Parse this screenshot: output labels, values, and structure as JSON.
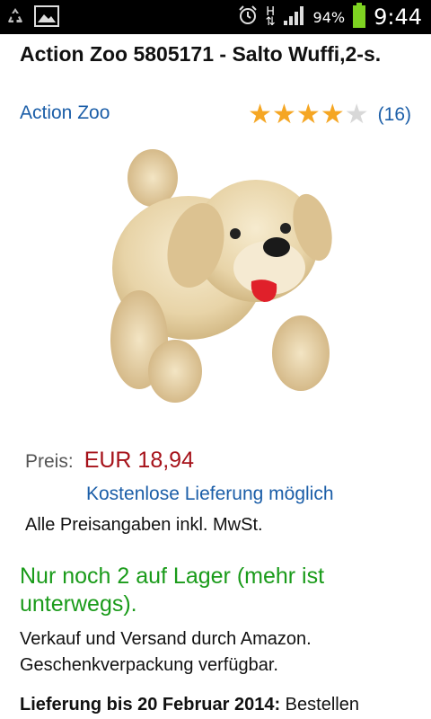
{
  "status_bar": {
    "battery_percent": "94%",
    "time": "9:44",
    "network": "H",
    "icons": [
      "recycle-icon",
      "image-icon",
      "alarm-icon",
      "signal-icon",
      "battery-icon"
    ]
  },
  "product": {
    "title": "Action Zoo 5805171 - Salto Wuffi,2-s.",
    "brand": "Action Zoo",
    "rating": 4,
    "rating_max": 5,
    "review_count": "(16)",
    "image_icon": "plush-dog-image"
  },
  "pricing": {
    "label": "Preis:",
    "value": "EUR 18,94",
    "delivery_link": "Kostenlose Lieferung möglich",
    "vat_note": "Alle Preisangaben inkl. MwSt."
  },
  "availability": {
    "stock": "Nur noch 2 auf Lager (mehr ist unterwegs).",
    "sold_by": "Verkauf und Versand durch Amazon. Geschenkverpackung verfügbar."
  },
  "delivery": {
    "bold_text": "Lieferung bis 20 Februar 2014:",
    "text": "Bestellen"
  },
  "colors": {
    "link": "#1b5ea8",
    "price": "#a6121a",
    "stock": "#1a9b1a",
    "star": "#f5a623"
  }
}
